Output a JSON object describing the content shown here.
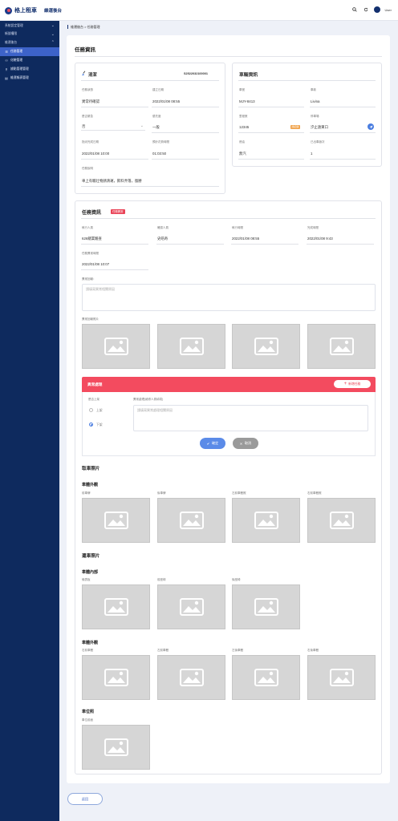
{
  "header": {
    "brand": "格上租車",
    "subtitle": "維運後台",
    "user_name": "User"
  },
  "sidebar": {
    "groups": [
      {
        "label": "系統設定管理"
      },
      {
        "label": "帳號權限"
      },
      {
        "label": "維運後台"
      }
    ],
    "items": [
      {
        "label": "任務管理",
        "icon": "list-icon",
        "active": true
      },
      {
        "label": "化驗管理",
        "icon": "users-icon"
      },
      {
        "label": "據點管理管理",
        "icon": "location-icon"
      },
      {
        "label": "維運報表管理",
        "icon": "report-icon"
      }
    ]
  },
  "breadcrumb": "維運後台 > 任務管理",
  "task_info": {
    "title": "任務資訊",
    "type": "清潔",
    "task_no": "S2522032100001",
    "fields": [
      {
        "label": "任務狀態",
        "value": "異常待確認"
      },
      {
        "label": "建立日期",
        "value": "2022/01/08 08:55"
      },
      {
        "label": "是否緊急",
        "value": "否"
      },
      {
        "label": "優先度",
        "value": "一般"
      },
      {
        "label": "指派完成日期",
        "value": "2022/01/08 10:00"
      },
      {
        "label": "預計花費時間",
        "value": "01:03:50"
      },
      {
        "label": "任務說明",
        "value": "車上有驅壮物請清運，飲料弄落，復勝"
      }
    ]
  },
  "vehicle_info": {
    "title": "車輛資訊",
    "fields": [
      {
        "label": "車號",
        "value": "MJY-8413"
      },
      {
        "label": "車款",
        "value": "Livina"
      },
      {
        "label": "里程數",
        "value": "12345",
        "tag": "請記錄"
      },
      {
        "label": "停車場",
        "value": "汐止遠東口"
      },
      {
        "label": "燃油",
        "value": "無汽"
      },
      {
        "label": "已出車趟次",
        "value": "1"
      }
    ]
  },
  "task_exec": {
    "title": "任務資訊",
    "badge": "任務異常",
    "fields": [
      {
        "label": "執行人員",
        "value": "626總業驗查"
      },
      {
        "label": "確認人員",
        "value": "史皓奇"
      },
      {
        "label": "執行時間",
        "value": "2022/01/08 08:55"
      },
      {
        "label": "完成時間",
        "value": "2022/01/08 9:43"
      },
      {
        "label": "任務異常時間",
        "value": "2022/01/08 10:07"
      }
    ],
    "abnormal_report_label": "異常回報：",
    "abnormal_report_placeholder": "請填寫異常相關原因",
    "abnormal_photo_label": "異常回報照片"
  },
  "abnormal_handling": {
    "title": "異常處理",
    "new_task_button": "新增任務",
    "radio_label": "是否上架",
    "options": [
      {
        "label": "上架",
        "checked": false
      },
      {
        "label": "下架",
        "checked": true
      }
    ],
    "desc_label": "異常處理(維修人員填寫)",
    "desc_placeholder": "請填寫異常處理相關原因",
    "confirm_button": "確定",
    "cancel_button": "取消"
  },
  "pickup_photos": {
    "title": "取車照片",
    "exterior_title": "車體外觀",
    "labels": [
      "前車牌",
      "後車牌",
      "左前車體照",
      "右前車體照"
    ]
  },
  "return_photos": {
    "title": "還車照片",
    "interior_title": "車體內部",
    "interior_labels": [
      "儀表板",
      "前座椅",
      "後座椅"
    ],
    "exterior_title": "車體外觀",
    "exterior_labels": [
      "右前車體",
      "左前車體",
      "左後車體",
      "右後車體"
    ],
    "parking_title": "車位照",
    "parking_labels": [
      "車位前面"
    ]
  },
  "back_button": "返回",
  "colors": {
    "sidebar": "#0e2a5e",
    "active": "#3d63c9",
    "danger": "#f34b5f",
    "primary": "#5b8be8"
  }
}
